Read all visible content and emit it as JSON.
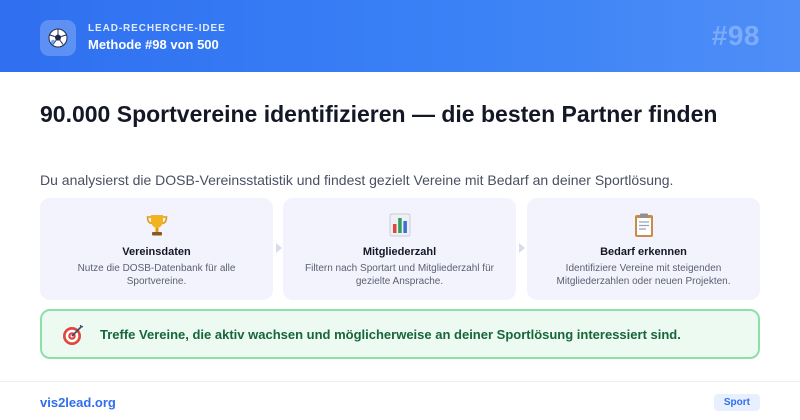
{
  "header": {
    "kicker": "LEAD-RECHERCHE-IDEE",
    "method": "Methode #98 von 500",
    "badge": "#98",
    "logo_icon": "soccer-ball-icon"
  },
  "main": {
    "title": "90.000 Sportvereine identifizieren — die besten Partner finden",
    "subtitle": "Du analysierst die DOSB-Vereinsstatistik und findest gezielt Vereine mit Bedarf an deiner Sportlösung."
  },
  "steps": [
    {
      "icon": "trophy-icon",
      "title": "Vereinsdaten",
      "desc": "Nutze die DOSB-Datenbank für alle Sportvereine."
    },
    {
      "icon": "bar-chart-icon",
      "title": "Mitgliederzahl",
      "desc": "Filtern nach Sportart und Mitgliederzahl für gezielte Ansprache."
    },
    {
      "icon": "clipboard-icon",
      "title": "Bedarf erkennen",
      "desc": "Identifiziere Vereine mit steigenden Mitgliederzahlen oder neuen Projekten."
    }
  ],
  "callout": {
    "icon": "target-icon",
    "text": "Treffe Vereine, die aktiv wachsen und möglicherweise an deiner Sportlösung interessiert sind."
  },
  "footer": {
    "link": "vis2lead.org",
    "tag": "Sport"
  },
  "colors": {
    "header_blue": "#2f6ff0",
    "callout_green": "#17663a",
    "step_bg": "#f3f3fd"
  }
}
